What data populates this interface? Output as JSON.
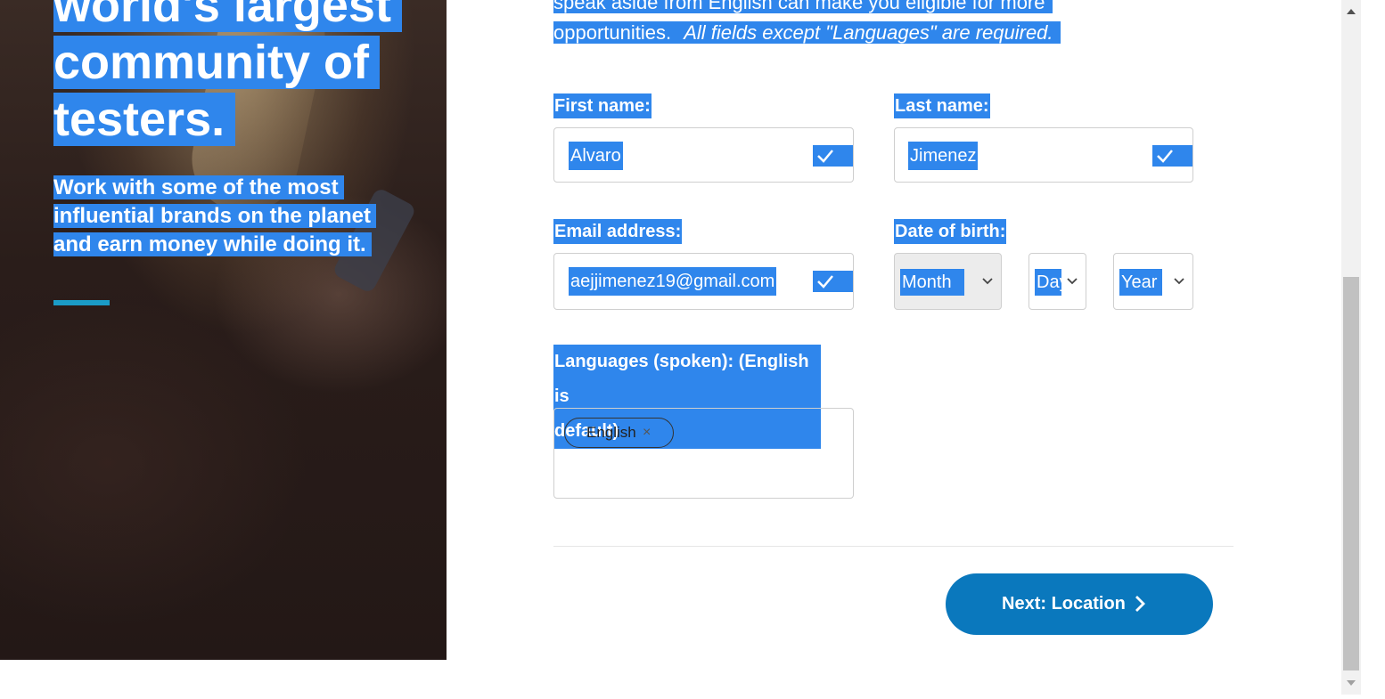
{
  "hero": {
    "title_line1": "world's largest",
    "title_line2": "community of",
    "title_line3": "testers.",
    "subtitle_line1": "Work with some of the most",
    "subtitle_line2": "influential brands on the planet",
    "subtitle_line3": "and earn money while doing it."
  },
  "intro": {
    "line1": "speak aside from English can make you eligible for more",
    "line2_plain": "opportunities.",
    "line2_italic": "All fields except \"Languages\" are required."
  },
  "form": {
    "first_name_label": "First name:",
    "first_name_value": "Alvaro",
    "last_name_label": "Last name:",
    "last_name_value": "Jimenez",
    "email_label": "Email address:",
    "email_value": "aejjimenez19@gmail.com",
    "dob_label": "Date of birth:",
    "dob_month": "Month",
    "dob_day": "Day",
    "dob_year": "Year",
    "languages_label_line1": "Languages (spoken): (English is",
    "languages_label_line2": "default)",
    "languages_selected": [
      "English"
    ],
    "chip_remove": "×"
  },
  "actions": {
    "next_label": "Next: Location"
  },
  "colors": {
    "selection": "#2f86ec",
    "primary_button": "#0a78bd",
    "accent_bar": "#1b9cc7"
  },
  "icons": {
    "field_valid": "check-icon",
    "dropdown": "chevron-down-icon",
    "next": "chevron-right-icon"
  }
}
